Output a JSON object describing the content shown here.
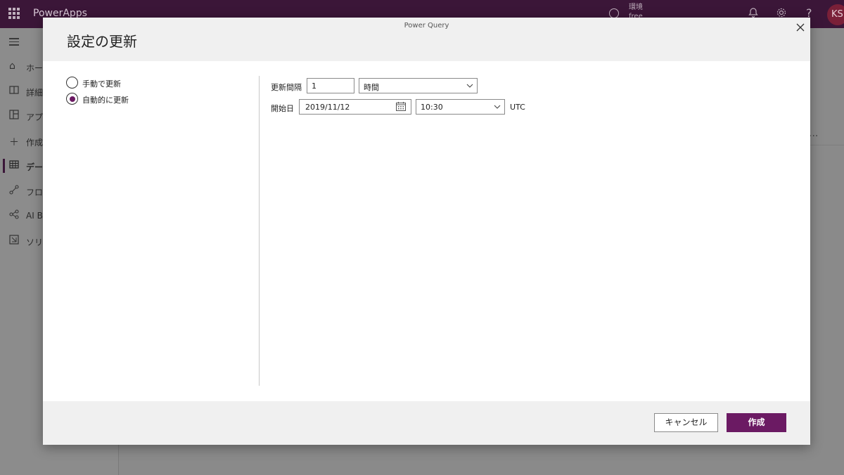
{
  "app": {
    "brand": "PowerApps",
    "env_label": "環境",
    "env_name": "free",
    "avatar_initials": "KS"
  },
  "sidebar": {
    "items": [
      {
        "label": "ホー",
        "icon": "home-icon"
      },
      {
        "label": "詳細",
        "icon": "book-icon"
      },
      {
        "label": "アプ",
        "icon": "apps-icon"
      },
      {
        "label": "作成",
        "icon": "plus-icon"
      },
      {
        "label": "デー",
        "icon": "table-icon",
        "active": true
      },
      {
        "label": "フロ",
        "icon": "flow-icon"
      },
      {
        "label": "AI Bu",
        "icon": "ai-builder-icon"
      },
      {
        "label": "ソリ",
        "icon": "solutions-icon"
      }
    ]
  },
  "dialog": {
    "source": "Power Query",
    "title": "設定の更新",
    "radios": [
      {
        "label": "手動で更新",
        "checked": false
      },
      {
        "label": "自動的に更新",
        "checked": true
      }
    ],
    "interval_label": "更新間隔",
    "interval_value": "1",
    "interval_unit": "時間",
    "start_label": "開始日",
    "start_date": "2019/11/12",
    "start_time": "10:30",
    "timezone": "UTC",
    "cancel_label": "キャンセル",
    "create_label": "作成"
  },
  "colors": {
    "accent": "#6b1a63",
    "topbar": "#3b1638"
  }
}
